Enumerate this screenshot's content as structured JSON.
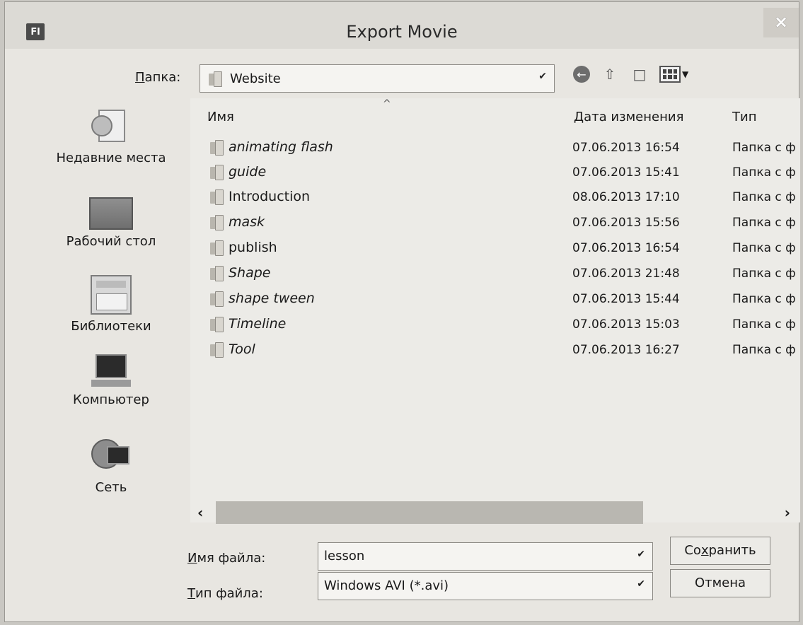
{
  "window": {
    "title": "Export Movie",
    "app_icon_text": "Fl",
    "close_glyph": "×"
  },
  "folder_row": {
    "label_underlined": "П",
    "label_rest": "апка:",
    "current_folder": "Website"
  },
  "places": [
    {
      "label": "Недавние места",
      "icon": "recent-places-icon"
    },
    {
      "label": "Рабочий стол",
      "icon": "desktop-icon"
    },
    {
      "label": "Библиотеки",
      "icon": "libraries-icon"
    },
    {
      "label": "Компьютер",
      "icon": "computer-icon"
    },
    {
      "label": "Сеть",
      "icon": "network-icon"
    }
  ],
  "columns": {
    "name": "Имя",
    "date": "Дата изменения",
    "type": "Тип"
  },
  "files": [
    {
      "name": "animating flash",
      "date": "07.06.2013 16:54",
      "type": "Папка с ф"
    },
    {
      "name": "guide",
      "date": "07.06.2013 15:41",
      "type": "Папка с ф"
    },
    {
      "name": "Introduction",
      "date": "08.06.2013 17:10",
      "type": "Папка с ф"
    },
    {
      "name": "mask",
      "date": "07.06.2013 15:56",
      "type": "Папка с ф"
    },
    {
      "name": "publish",
      "date": "07.06.2013 16:54",
      "type": "Папка с ф"
    },
    {
      "name": "Shape",
      "date": "07.06.2013 21:48",
      "type": "Папка с ф"
    },
    {
      "name": "shape tween",
      "date": "07.06.2013 15:44",
      "type": "Папка с ф"
    },
    {
      "name": "Timeline",
      "date": "07.06.2013 15:03",
      "type": "Папка с ф"
    },
    {
      "name": "Tool",
      "date": "07.06.2013 16:27",
      "type": "Папка с ф"
    }
  ],
  "filename": {
    "label_underlined": "И",
    "label_rest": "мя файла:",
    "value": "lesson"
  },
  "filetype": {
    "label_underlined": "Т",
    "label_rest": "ип файла:",
    "value": "Windows AVI (*.avi)"
  },
  "buttons": {
    "save_pre": "Со",
    "save_underlined": "х",
    "save_post": "ранить",
    "cancel": "Отмена"
  },
  "colors": {
    "window_bg": "#e8e6e1",
    "titlebar": "#dcdad5"
  }
}
